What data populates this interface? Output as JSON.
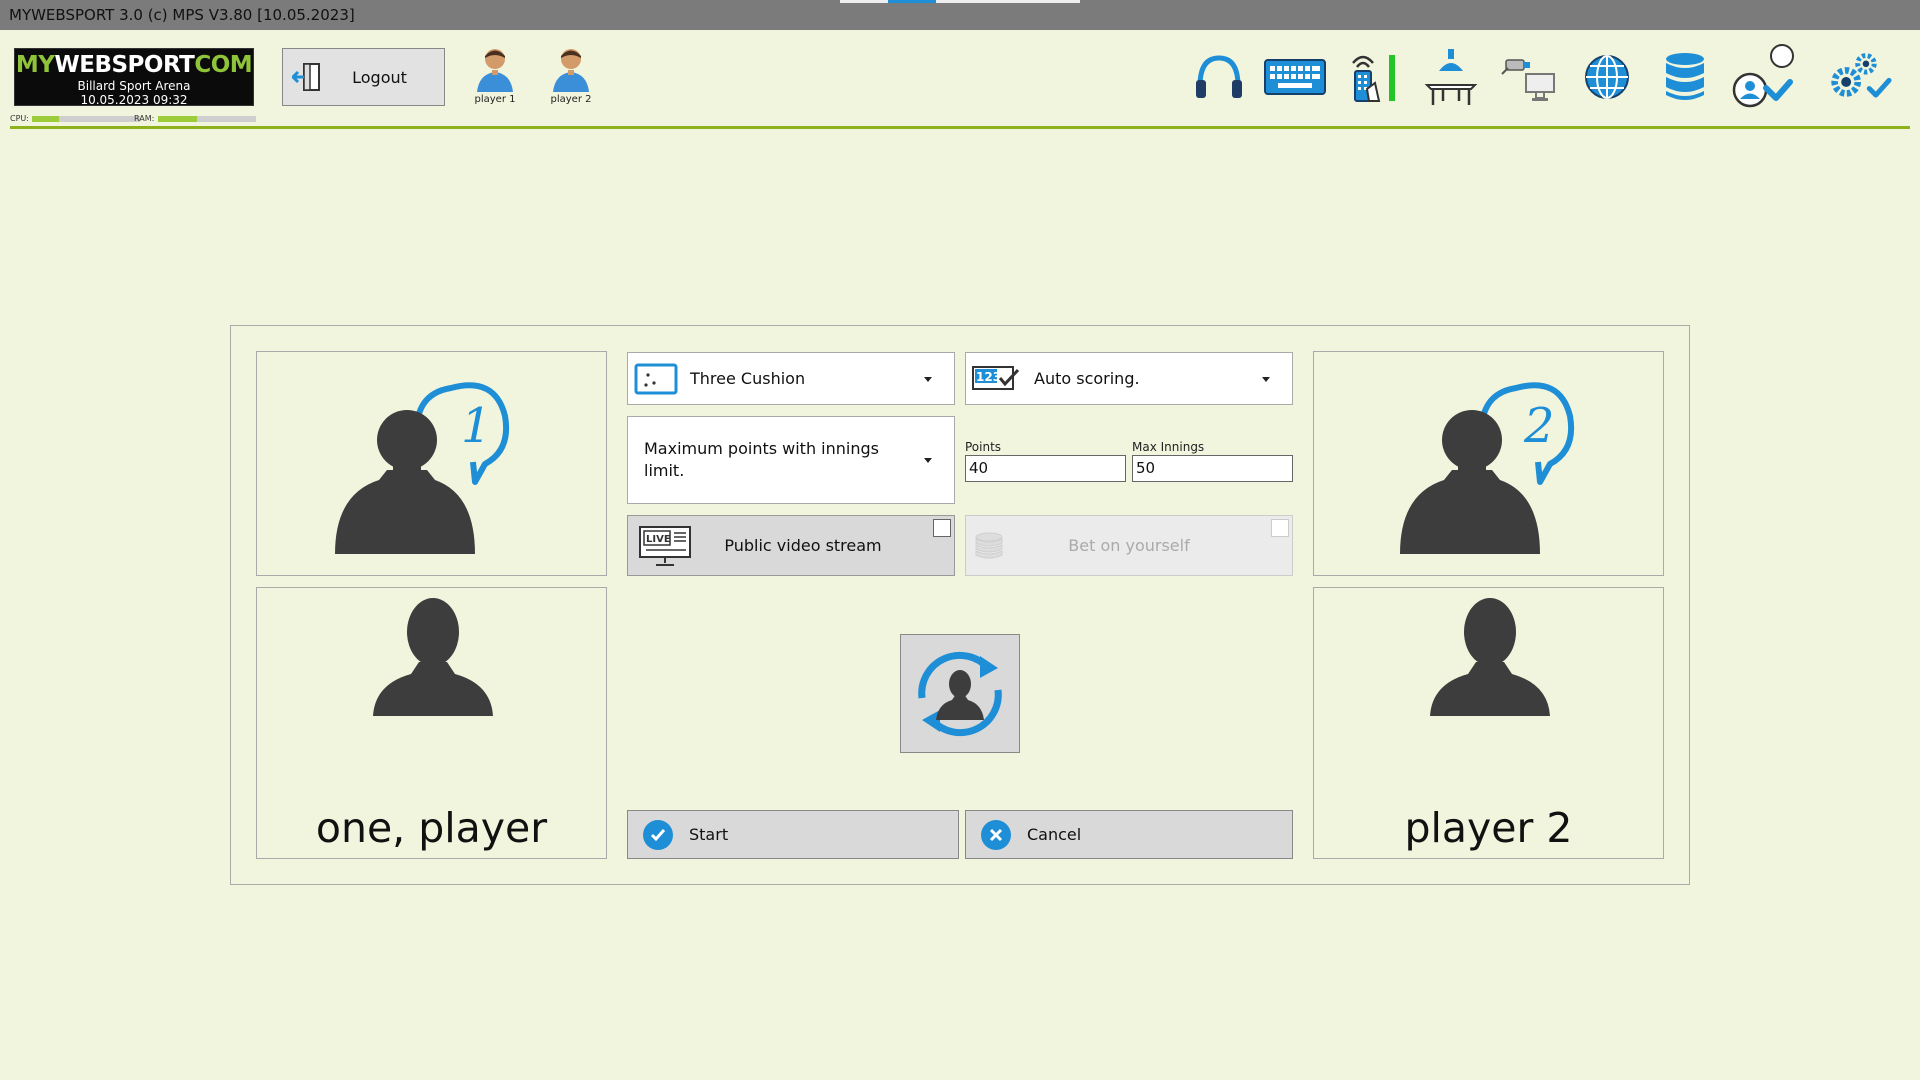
{
  "window": {
    "title": "MYWEBSPORT 3.0  (c) MPS V3.80 [10.05.2023]"
  },
  "logo": {
    "brand_a": "MY",
    "brand_b": "WEBSPORT",
    "brand_c": "COM",
    "venue": "Billard Sport Arena",
    "datetime": "10.05.2023  09:32"
  },
  "meters": {
    "cpu_label": "CPU:",
    "ram_label": "RAM:",
    "cpu_level": 0.25,
    "ram_level": 0.4
  },
  "header": {
    "logout_label": "Logout",
    "players": [
      "player 1",
      "player 2"
    ],
    "tools": [
      "headphones-icon",
      "keyboard-icon",
      "remote-control-icon",
      "table-light-icon",
      "camera-monitor-icon",
      "globe-icon",
      "database-icon",
      "user-check-icon",
      "settings-check-icon"
    ]
  },
  "game": {
    "discipline": "Three Cushion",
    "scoring": "Auto scoring.",
    "mode_line1": "Maximum points with innings",
    "mode_line2": "limit.",
    "points_label": "Points",
    "points_value": "40",
    "innings_label": "Max Innings",
    "innings_value": "50",
    "video_stream_label": "Public video stream",
    "bet_label": "Bet on yourself",
    "start_label": "Start",
    "cancel_label": "Cancel"
  },
  "player1": {
    "name": "one, player",
    "badge": "1"
  },
  "player2": {
    "name": "player 2",
    "badge": "2"
  },
  "colors": {
    "accent": "#1e8fd6",
    "silhouette": "#3d3d3d",
    "background": "#f2f5de",
    "header_line": "#8fb21c"
  }
}
